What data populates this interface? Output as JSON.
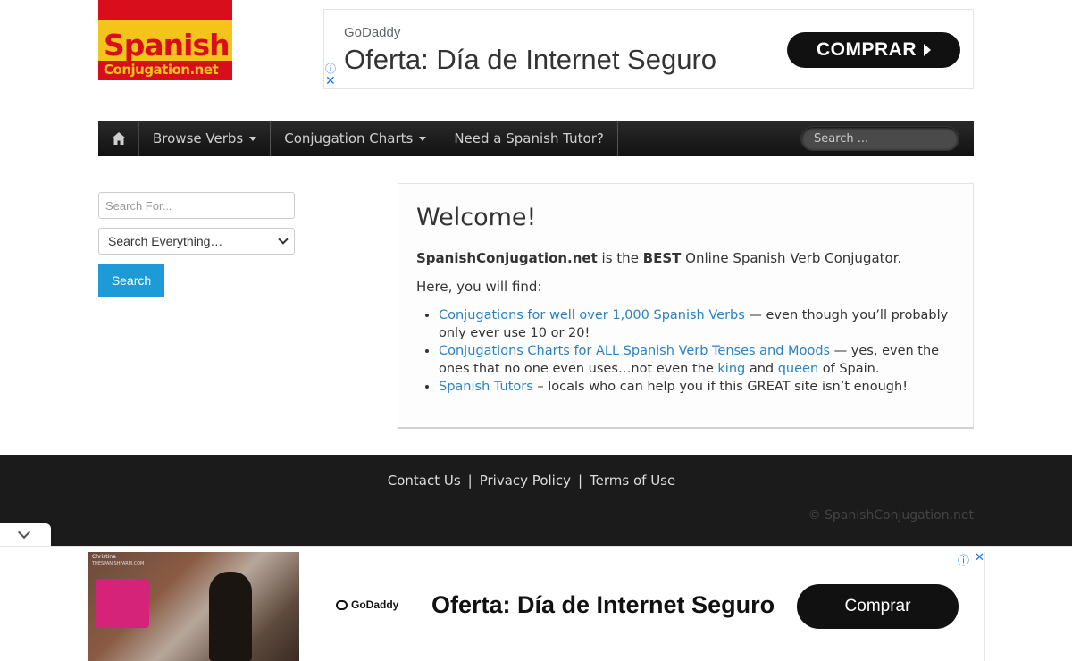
{
  "logo": {
    "line1": "Spanish",
    "line2": "Conjugation.net"
  },
  "ad_top": {
    "brand": "GoDaddy",
    "headline": "Oferta: Día de Internet Seguro",
    "button": "COMPRAR",
    "info_icon": "ⓘ",
    "close_icon": "✕"
  },
  "nav": {
    "home_icon": "home-icon",
    "items": [
      {
        "label": "Browse Verbs",
        "dropdown": true
      },
      {
        "label": "Conjugation Charts",
        "dropdown": true
      },
      {
        "label": "Need a Spanish Tutor?",
        "dropdown": false
      }
    ],
    "search_placeholder": "Search ..."
  },
  "sidebar": {
    "search_placeholder": "Search For...",
    "select_value": "Search Everything…",
    "button": "Search"
  },
  "welcome": {
    "title": "Welcome!",
    "intro_site": "SpanishConjugation.net",
    "intro_mid": " is the ",
    "intro_best": "BEST",
    "intro_end": " Online Spanish Verb Conjugator.",
    "find": "Here, you will find:",
    "items": [
      {
        "link": "Conjugations for well over 1,000 Spanish Verbs",
        "text": " — even though you’ll probably only ever use 10 or 20!"
      },
      {
        "link": "Conjugations Charts for ALL Spanish Verb Tenses and Moods",
        "text": " — yes, even the ones that no one even uses…not even the ",
        "link2": "king",
        "text2": " and ",
        "link3": "queen",
        "text3": " of Spain."
      },
      {
        "link": "Spanish Tutors",
        "text": " – locals who can help you if this GREAT site isn’t enough!"
      }
    ]
  },
  "footer": {
    "links": [
      "Contact Us",
      "Privacy Policy",
      "Terms of Use"
    ],
    "separator": "|",
    "copyright": "© SpanishConjugation.net"
  },
  "ad_bottom": {
    "caption1": "Christina",
    "caption2": "THESPANISHFARM.COM",
    "brand": "GoDaddy",
    "headline": "Oferta: Día de Internet Seguro",
    "button": "Comprar",
    "info_icon": "ⓘ",
    "close_icon": "✕"
  },
  "colors": {
    "link": "#2a82c4",
    "accent": "#1e9ad6",
    "footer_bg": "#1b1b1b",
    "logo_red": "#d90e1c",
    "logo_yellow": "#f3c51b"
  }
}
